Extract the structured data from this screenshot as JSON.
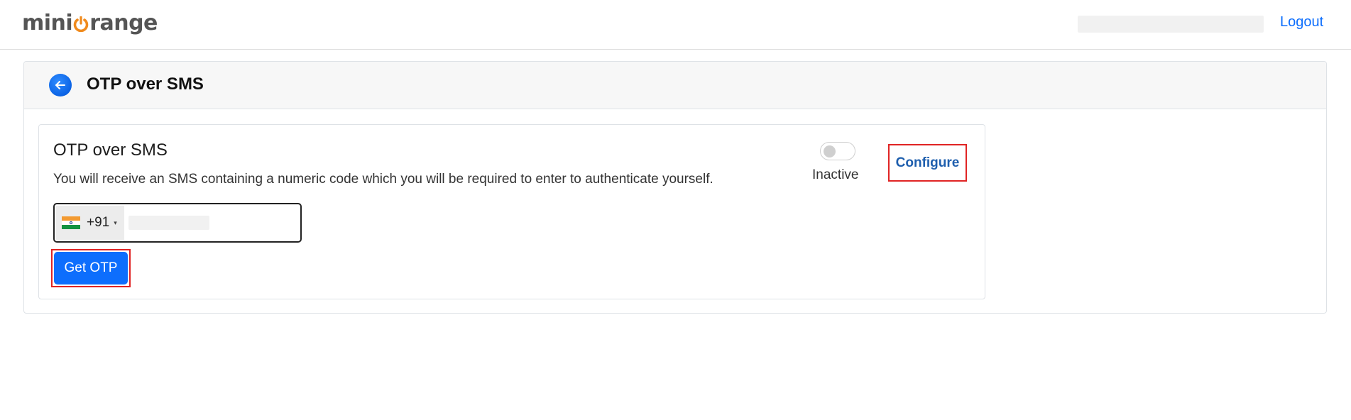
{
  "header": {
    "logo_text_left": "mini",
    "logo_text_right": "range",
    "logo_icon": "orange-power-o-icon",
    "logout_label": "Logout"
  },
  "page": {
    "title": "OTP over SMS",
    "back_icon": "arrow-left-icon"
  },
  "method_card": {
    "title": "OTP over SMS",
    "description": "You will receive an SMS containing a numeric code which you will be required to enter to authenticate yourself.",
    "phone": {
      "country_flag": "india-flag-icon",
      "dial_code": "+91",
      "caret": "▾",
      "value": ""
    },
    "get_otp_label": "Get OTP",
    "status_label": "Inactive",
    "toggle_enabled": false,
    "configure_label": "Configure"
  },
  "colors": {
    "primary": "#0d6efd",
    "highlight_border": "#e02424",
    "configure_link": "#1f5fae",
    "logo_orange": "#f08a1c"
  }
}
